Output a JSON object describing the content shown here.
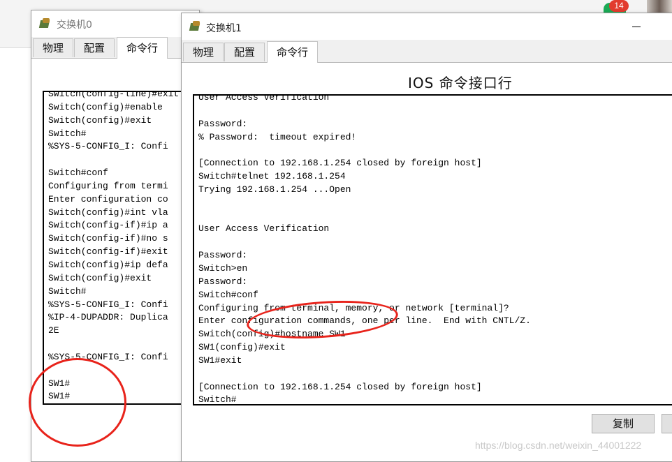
{
  "notifications": {
    "badge_count": "14"
  },
  "window0": {
    "title": "交换机0",
    "tabs": [
      "物理",
      "配置",
      "命令行"
    ],
    "active_tab": "命令行",
    "terminal_lines": [
      "Switch(config-line)#exit",
      "Switch(config)#enable",
      "Switch(config)#exit",
      "Switch#",
      "%SYS-5-CONFIG_I: Confi",
      "",
      "Switch#conf",
      "Configuring from termi",
      "Enter configuration co",
      "Switch(config)#int vla",
      "Switch(config-if)#ip a",
      "Switch(config-if)#no s",
      "Switch(config-if)#exit",
      "Switch(config)#ip defa",
      "Switch(config)#exit",
      "Switch#",
      "%SYS-5-CONFIG_I: Confi",
      "%IP-4-DUPADDR: Duplica",
      "2E",
      "",
      "%SYS-5-CONFIG_I: Confi",
      "",
      "SW1#",
      "SW1#"
    ]
  },
  "window1": {
    "title": "交换机1",
    "tabs": [
      "物理",
      "配置",
      "命令行"
    ],
    "active_tab": "命令行",
    "heading": "IOS 命令接口行",
    "terminal_lines": [
      "User Access Verification",
      "",
      "Password:",
      "% Password:  timeout expired!",
      "",
      "[Connection to 192.168.1.254 closed by foreign host]",
      "Switch#telnet 192.168.1.254",
      "Trying 192.168.1.254 ...Open",
      "",
      "",
      "User Access Verification",
      "",
      "Password:",
      "Switch>en",
      "Password:",
      "Switch#conf",
      "Configuring from terminal, memory, or network [terminal]?",
      "Enter configuration commands, one per line.  End with CNTL/Z.",
      "Switch(config)#hostname SW1",
      "SW1(config)#exit",
      "SW1#exit",
      "",
      "[Connection to 192.168.1.254 closed by foreign host]",
      "Switch#"
    ],
    "copy_button": "复制"
  },
  "watermark": "https://blog.csdn.net/weixin_44001222",
  "colors": {
    "annotation_red": "#e8231b",
    "badge_green": "#1aaa55",
    "badge_red": "#e23b2e"
  }
}
